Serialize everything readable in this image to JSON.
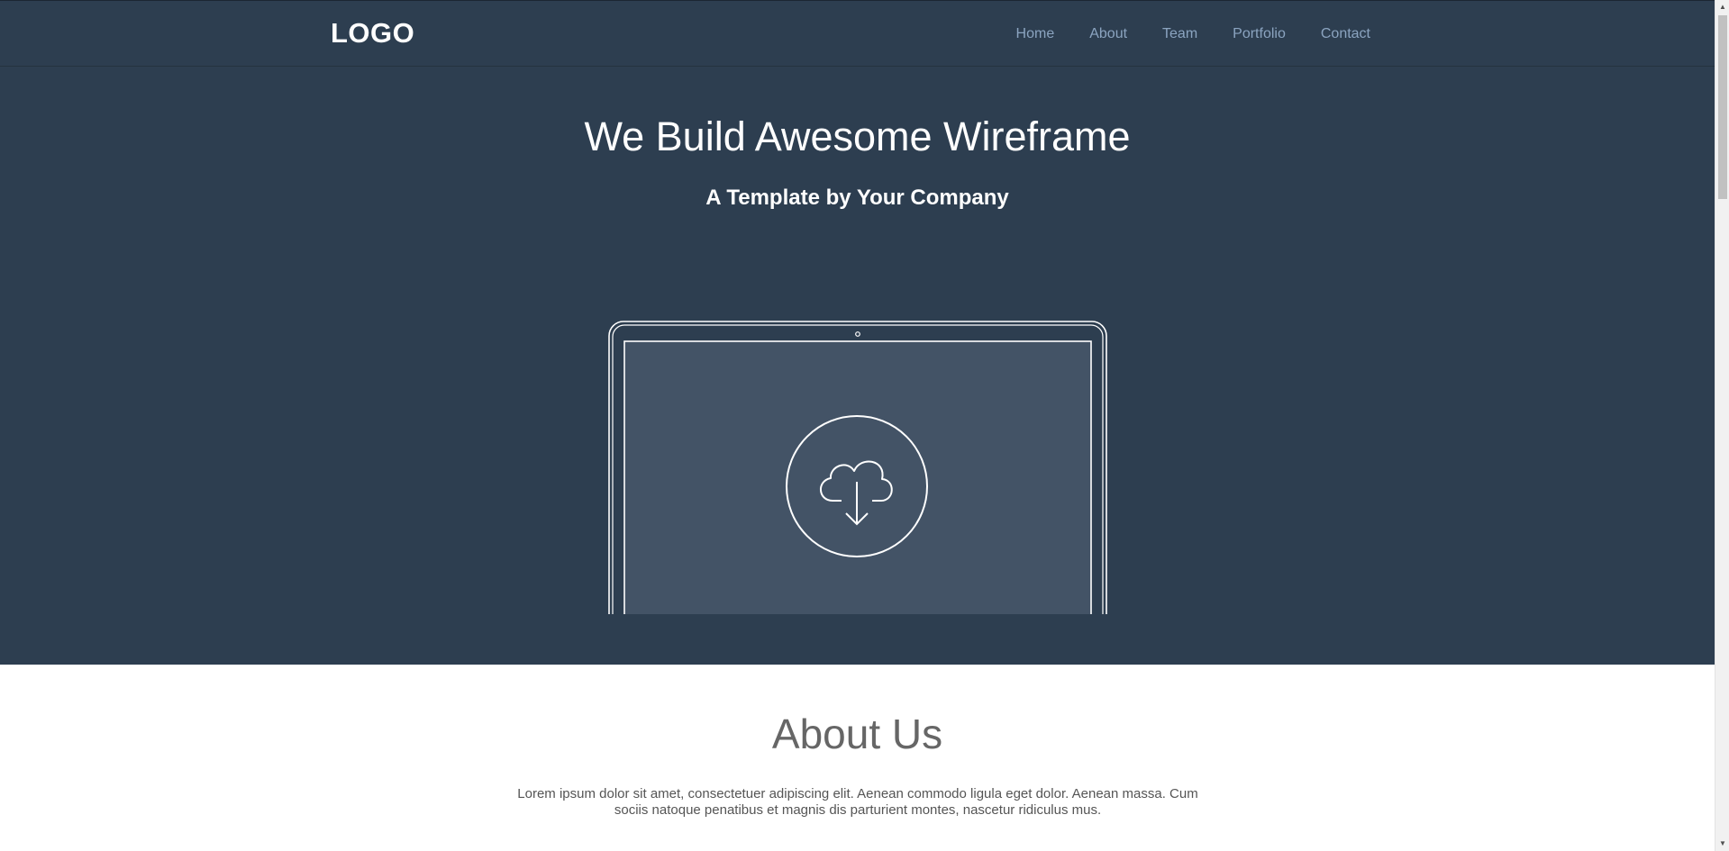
{
  "nav": {
    "logo": "LOGO",
    "items": [
      "Home",
      "About",
      "Team",
      "Portfolio",
      "Contact"
    ]
  },
  "hero": {
    "title": "We Build Awesome Wireframe",
    "subtitle": "A Template by Your Company",
    "illustration_icon": "laptop-cloud-download-icon"
  },
  "about": {
    "title": "About Us",
    "text": "Lorem ipsum dolor sit amet, consectetuer adipiscing elit. Aenean commodo ligula eget dolor. Aenean massa. Cum sociis natoque penatibus et magnis dis parturient montes, nascetur ridiculus mus."
  },
  "colors": {
    "nav_bg": "#2d3e50",
    "nav_link": "#8ba4c0",
    "hero_bg": "#2d3e50",
    "screen_fill": "#435366",
    "about_title": "#666666"
  }
}
